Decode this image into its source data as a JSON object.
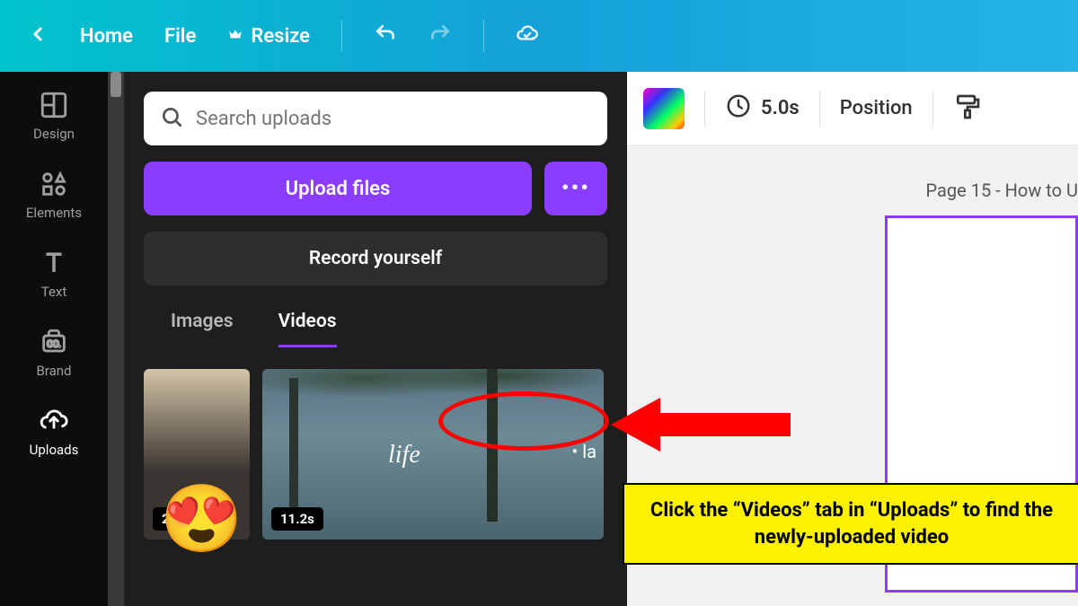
{
  "topbar": {
    "home": "Home",
    "file": "File",
    "resize": "Resize"
  },
  "sidebar": {
    "design": "Design",
    "elements": "Elements",
    "text": "Text",
    "brand": "Brand",
    "uploads": "Uploads"
  },
  "panel": {
    "search_placeholder": "Search uploads",
    "upload_files": "Upload files",
    "record_yourself": "Record yourself",
    "tab_images": "Images",
    "tab_videos": "Videos",
    "thumbs": {
      "d1": "24.3s",
      "d2": "11.2s",
      "life": "life",
      "la": "• la"
    }
  },
  "canvas": {
    "timing": "5.0s",
    "position": "Position",
    "page_label": "Page 15 - How to U"
  },
  "annotation": {
    "callout": "Click the “Videos” tab in “Uploads” to find the newly-uploaded video",
    "emoji": "😍"
  }
}
